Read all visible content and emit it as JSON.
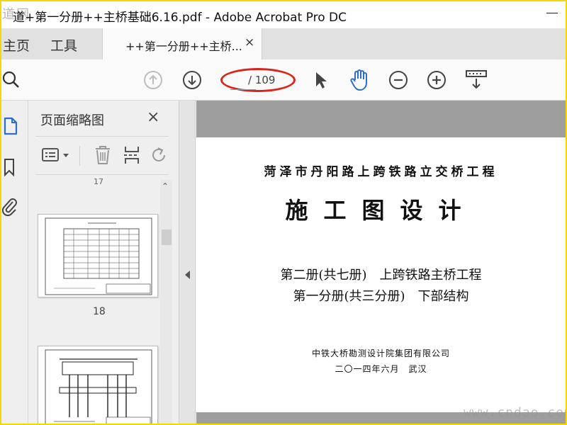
{
  "window": {
    "title": "道+第一分册++主桥基础6.16.pdf - Adobe Acrobat Pro DC",
    "watermark_top": "道网"
  },
  "tabs": {
    "home": "主页",
    "tools": "工具",
    "document": "++第一分册++主桥...",
    "close": "×"
  },
  "toolbar": {
    "page_total": "/ 109",
    "icons": [
      "search-icon",
      "page-up-icon",
      "page-down-icon",
      "select-arrow-icon",
      "hand-tool-icon",
      "zoom-out-icon",
      "zoom-in-icon",
      "scroll-mode-icon"
    ],
    "accent": "#2d6fc2",
    "highlight": "#d9261c"
  },
  "sidebar": {
    "title": "页面缩略图",
    "close": "×",
    "prev_page_label": "17",
    "thumbnails": [
      {
        "label": "18"
      },
      {
        "label": ""
      }
    ]
  },
  "document": {
    "line1": "菏泽市丹阳路上跨铁路立交桥工程",
    "line2": "施工图设计",
    "line3": "第二册(共七册)　上跨铁路主桥工程",
    "line4": "第一分册(共三分册)　下部结构",
    "line5": "中铁大桥勘测设计院集团有限公司",
    "line6": "二〇一四年六月　武汉"
  },
  "watermark": "www.cndao.com"
}
